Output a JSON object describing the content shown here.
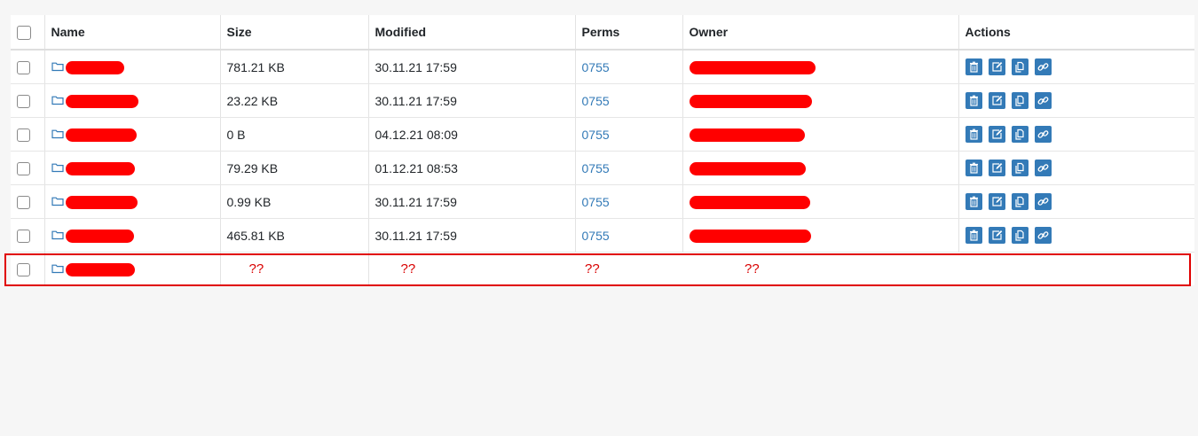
{
  "table": {
    "headers": [
      "Name",
      "Size",
      "Modified",
      "Perms",
      "Owner",
      "Actions"
    ],
    "rows": [
      {
        "size": "781.21 KB",
        "modified": "30.11.21 17:59",
        "perms": "0755"
      },
      {
        "size": "23.22 KB",
        "modified": "30.11.21 17:59",
        "perms": "0755"
      },
      {
        "size": "0 B",
        "modified": "04.12.21 08:09",
        "perms": "0755"
      },
      {
        "size": "79.29 KB",
        "modified": "01.12.21 08:53",
        "perms": "0755"
      },
      {
        "size": "0.99 KB",
        "modified": "30.11.21 17:59",
        "perms": "0755"
      },
      {
        "size": "465.81 KB",
        "modified": "30.11.21 17:59",
        "perms": "0755"
      }
    ],
    "highlighted_row": {
      "size": "??",
      "modified": "??",
      "perms": "??",
      "owner": "??"
    }
  },
  "icons": {
    "row_icon": "folder-icon",
    "actions": [
      "trash-icon",
      "edit-icon",
      "copy-icon",
      "link-icon"
    ]
  },
  "colors": {
    "accent": "#337ab7",
    "redaction": "#ff0000",
    "highlight_border": "#e00000"
  }
}
